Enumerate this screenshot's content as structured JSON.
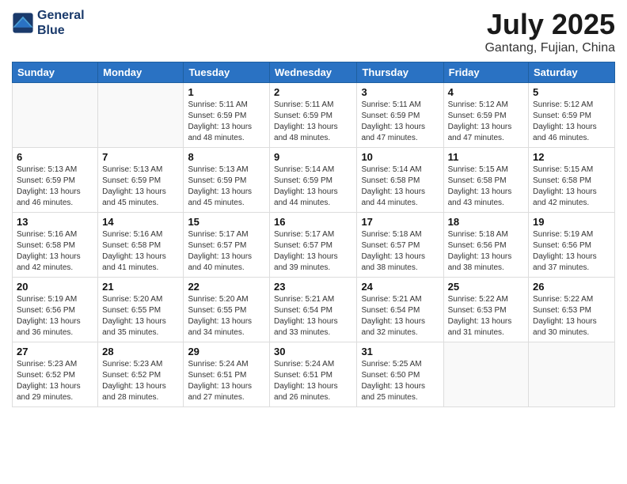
{
  "header": {
    "logo_line1": "General",
    "logo_line2": "Blue",
    "month_title": "July 2025",
    "location": "Gantang, Fujian, China"
  },
  "weekdays": [
    "Sunday",
    "Monday",
    "Tuesday",
    "Wednesday",
    "Thursday",
    "Friday",
    "Saturday"
  ],
  "weeks": [
    [
      {
        "day": "",
        "info": ""
      },
      {
        "day": "",
        "info": ""
      },
      {
        "day": "1",
        "info": "Sunrise: 5:11 AM\nSunset: 6:59 PM\nDaylight: 13 hours and 48 minutes."
      },
      {
        "day": "2",
        "info": "Sunrise: 5:11 AM\nSunset: 6:59 PM\nDaylight: 13 hours and 48 minutes."
      },
      {
        "day": "3",
        "info": "Sunrise: 5:11 AM\nSunset: 6:59 PM\nDaylight: 13 hours and 47 minutes."
      },
      {
        "day": "4",
        "info": "Sunrise: 5:12 AM\nSunset: 6:59 PM\nDaylight: 13 hours and 47 minutes."
      },
      {
        "day": "5",
        "info": "Sunrise: 5:12 AM\nSunset: 6:59 PM\nDaylight: 13 hours and 46 minutes."
      }
    ],
    [
      {
        "day": "6",
        "info": "Sunrise: 5:13 AM\nSunset: 6:59 PM\nDaylight: 13 hours and 46 minutes."
      },
      {
        "day": "7",
        "info": "Sunrise: 5:13 AM\nSunset: 6:59 PM\nDaylight: 13 hours and 45 minutes."
      },
      {
        "day": "8",
        "info": "Sunrise: 5:13 AM\nSunset: 6:59 PM\nDaylight: 13 hours and 45 minutes."
      },
      {
        "day": "9",
        "info": "Sunrise: 5:14 AM\nSunset: 6:59 PM\nDaylight: 13 hours and 44 minutes."
      },
      {
        "day": "10",
        "info": "Sunrise: 5:14 AM\nSunset: 6:58 PM\nDaylight: 13 hours and 44 minutes."
      },
      {
        "day": "11",
        "info": "Sunrise: 5:15 AM\nSunset: 6:58 PM\nDaylight: 13 hours and 43 minutes."
      },
      {
        "day": "12",
        "info": "Sunrise: 5:15 AM\nSunset: 6:58 PM\nDaylight: 13 hours and 42 minutes."
      }
    ],
    [
      {
        "day": "13",
        "info": "Sunrise: 5:16 AM\nSunset: 6:58 PM\nDaylight: 13 hours and 42 minutes."
      },
      {
        "day": "14",
        "info": "Sunrise: 5:16 AM\nSunset: 6:58 PM\nDaylight: 13 hours and 41 minutes."
      },
      {
        "day": "15",
        "info": "Sunrise: 5:17 AM\nSunset: 6:57 PM\nDaylight: 13 hours and 40 minutes."
      },
      {
        "day": "16",
        "info": "Sunrise: 5:17 AM\nSunset: 6:57 PM\nDaylight: 13 hours and 39 minutes."
      },
      {
        "day": "17",
        "info": "Sunrise: 5:18 AM\nSunset: 6:57 PM\nDaylight: 13 hours and 38 minutes."
      },
      {
        "day": "18",
        "info": "Sunrise: 5:18 AM\nSunset: 6:56 PM\nDaylight: 13 hours and 38 minutes."
      },
      {
        "day": "19",
        "info": "Sunrise: 5:19 AM\nSunset: 6:56 PM\nDaylight: 13 hours and 37 minutes."
      }
    ],
    [
      {
        "day": "20",
        "info": "Sunrise: 5:19 AM\nSunset: 6:56 PM\nDaylight: 13 hours and 36 minutes."
      },
      {
        "day": "21",
        "info": "Sunrise: 5:20 AM\nSunset: 6:55 PM\nDaylight: 13 hours and 35 minutes."
      },
      {
        "day": "22",
        "info": "Sunrise: 5:20 AM\nSunset: 6:55 PM\nDaylight: 13 hours and 34 minutes."
      },
      {
        "day": "23",
        "info": "Sunrise: 5:21 AM\nSunset: 6:54 PM\nDaylight: 13 hours and 33 minutes."
      },
      {
        "day": "24",
        "info": "Sunrise: 5:21 AM\nSunset: 6:54 PM\nDaylight: 13 hours and 32 minutes."
      },
      {
        "day": "25",
        "info": "Sunrise: 5:22 AM\nSunset: 6:53 PM\nDaylight: 13 hours and 31 minutes."
      },
      {
        "day": "26",
        "info": "Sunrise: 5:22 AM\nSunset: 6:53 PM\nDaylight: 13 hours and 30 minutes."
      }
    ],
    [
      {
        "day": "27",
        "info": "Sunrise: 5:23 AM\nSunset: 6:52 PM\nDaylight: 13 hours and 29 minutes."
      },
      {
        "day": "28",
        "info": "Sunrise: 5:23 AM\nSunset: 6:52 PM\nDaylight: 13 hours and 28 minutes."
      },
      {
        "day": "29",
        "info": "Sunrise: 5:24 AM\nSunset: 6:51 PM\nDaylight: 13 hours and 27 minutes."
      },
      {
        "day": "30",
        "info": "Sunrise: 5:24 AM\nSunset: 6:51 PM\nDaylight: 13 hours and 26 minutes."
      },
      {
        "day": "31",
        "info": "Sunrise: 5:25 AM\nSunset: 6:50 PM\nDaylight: 13 hours and 25 minutes."
      },
      {
        "day": "",
        "info": ""
      },
      {
        "day": "",
        "info": ""
      }
    ]
  ]
}
